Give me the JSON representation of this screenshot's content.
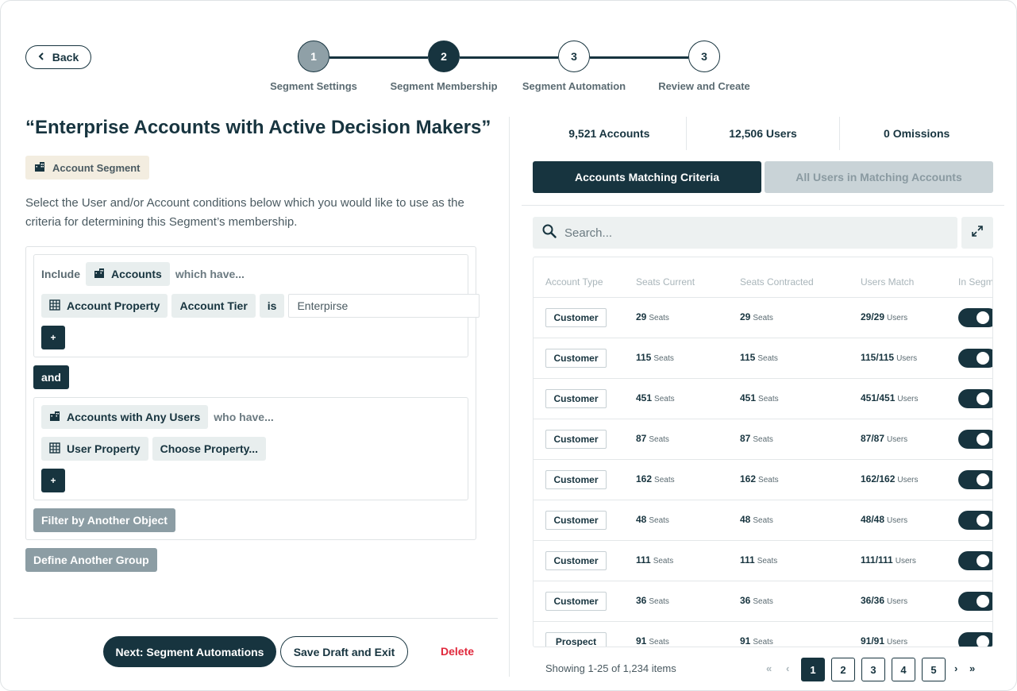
{
  "header": {
    "back_label": "Back"
  },
  "stepper": [
    {
      "number": "1",
      "label": "Segment Settings",
      "state": "done"
    },
    {
      "number": "2",
      "label": "Segment Membership",
      "state": "active"
    },
    {
      "number": "3",
      "label": "Segment Automation",
      "state": "upcoming"
    },
    {
      "number": "3",
      "label": "Review and Create",
      "state": "upcoming"
    }
  ],
  "segment": {
    "title": "“Enterprise Accounts with Active Decision Makers”",
    "badge": "Account Segment",
    "description": "Select the User and/or Account conditions below which you would like to use as the criteria for determining this Segment’s membership."
  },
  "group1": {
    "include_label": "Include",
    "object": "Accounts",
    "suffix": "which have...",
    "property_type": "Account Property",
    "property": "Account Tier",
    "operator": "is",
    "value": "Enterpirse",
    "add_label": "+"
  },
  "and_label": "and",
  "group2": {
    "object": "Accounts with Any Users",
    "suffix": "who have...",
    "property_type": "User Property",
    "property": "Choose Property...",
    "add_label": "+"
  },
  "filter_another_label": "Filter by Another Object",
  "define_group_label": "Define Another Group",
  "footer": {
    "next_label": "Next: Segment Automations",
    "save_label": "Save Draft and Exit",
    "delete_label": "Delete"
  },
  "stats": {
    "accounts": "9,521 Accounts",
    "users": "12,506 Users",
    "omissions": "0 Omissions"
  },
  "tabs": {
    "active": "Accounts Matching Criteria",
    "inactive": "All Users in Matching Accounts"
  },
  "search": {
    "placeholder": "Search..."
  },
  "table": {
    "columns": [
      "Account Type",
      "Seats Current",
      "Seats Contracted",
      "Users Match",
      "In Segment"
    ],
    "seats_unit": "Seats",
    "users_unit": "Users",
    "rows": [
      {
        "type": "Customer",
        "current": "29",
        "contracted": "29",
        "match": "29/29",
        "in_segment": true
      },
      {
        "type": "Customer",
        "current": "115",
        "contracted": "115",
        "match": "115/115",
        "in_segment": true
      },
      {
        "type": "Customer",
        "current": "451",
        "contracted": "451",
        "match": "451/451",
        "in_segment": true
      },
      {
        "type": "Customer",
        "current": "87",
        "contracted": "87",
        "match": "87/87",
        "in_segment": true
      },
      {
        "type": "Customer",
        "current": "162",
        "contracted": "162",
        "match": "162/162",
        "in_segment": true
      },
      {
        "type": "Customer",
        "current": "48",
        "contracted": "48",
        "match": "48/48",
        "in_segment": true
      },
      {
        "type": "Customer",
        "current": "111",
        "contracted": "111",
        "match": "111/111",
        "in_segment": true
      },
      {
        "type": "Customer",
        "current": "36",
        "contracted": "36",
        "match": "36/36",
        "in_segment": true
      },
      {
        "type": "Prospect",
        "current": "91",
        "contracted": "91",
        "match": "91/91",
        "in_segment": true
      }
    ]
  },
  "pagination": {
    "showing": "Showing 1-25 of 1,234 items",
    "pages": [
      "1",
      "2",
      "3",
      "4",
      "5"
    ],
    "current_page": "1",
    "first": "«",
    "prev": "‹",
    "next": "›",
    "last": "»"
  },
  "colors": {
    "primary": "#17343f",
    "muted_button": "#8c9da4",
    "danger": "#e0283c",
    "badge_bg": "#f3ede0"
  },
  "icons": {
    "back": "chevron-left-icon",
    "accounts": "building-icon",
    "property": "table-grid-icon",
    "search": "search-icon",
    "expand": "expand-icon"
  }
}
